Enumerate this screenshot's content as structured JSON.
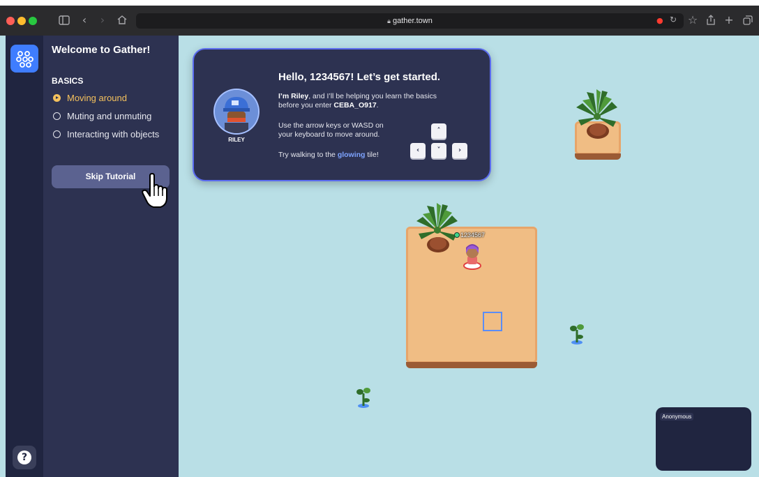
{
  "browser": {
    "url": "gather.town"
  },
  "sidebar": {
    "title": "Welcome to Gather!",
    "section": "BASICS",
    "items": [
      {
        "label": "Moving around",
        "active": true
      },
      {
        "label": "Muting and unmuting",
        "active": false
      },
      {
        "label": "Interacting with objects",
        "active": false
      }
    ],
    "skip_label": "Skip Tutorial"
  },
  "dialog": {
    "character_name": "RILEY",
    "title": "Hello, 1234567! Let’s get started.",
    "intro_bold": "I’m Riley",
    "intro_rest": ", and I’ll be helping you learn the basics",
    "intro_line2": "before you enter ",
    "space_name": "CEBA_O917",
    "intro_end": ".",
    "move_line1": "Use the arrow keys or WASD on",
    "move_line2": "your keyboard to move around.",
    "try_start": "Try walking to the ",
    "try_glow": "glowing",
    "try_end": " tile!",
    "keys": {
      "up": "˄",
      "left": "‹",
      "down": "˅",
      "right": "›"
    }
  },
  "game": {
    "player_name": "1234567"
  },
  "video": {
    "name": "Anonymous"
  },
  "colors": {
    "accent": "#3f7dff",
    "sidebar_bg": "#2d3251",
    "active_item": "#f4c15d",
    "water": "#b9dfe6",
    "sand": "#f0bd84"
  }
}
